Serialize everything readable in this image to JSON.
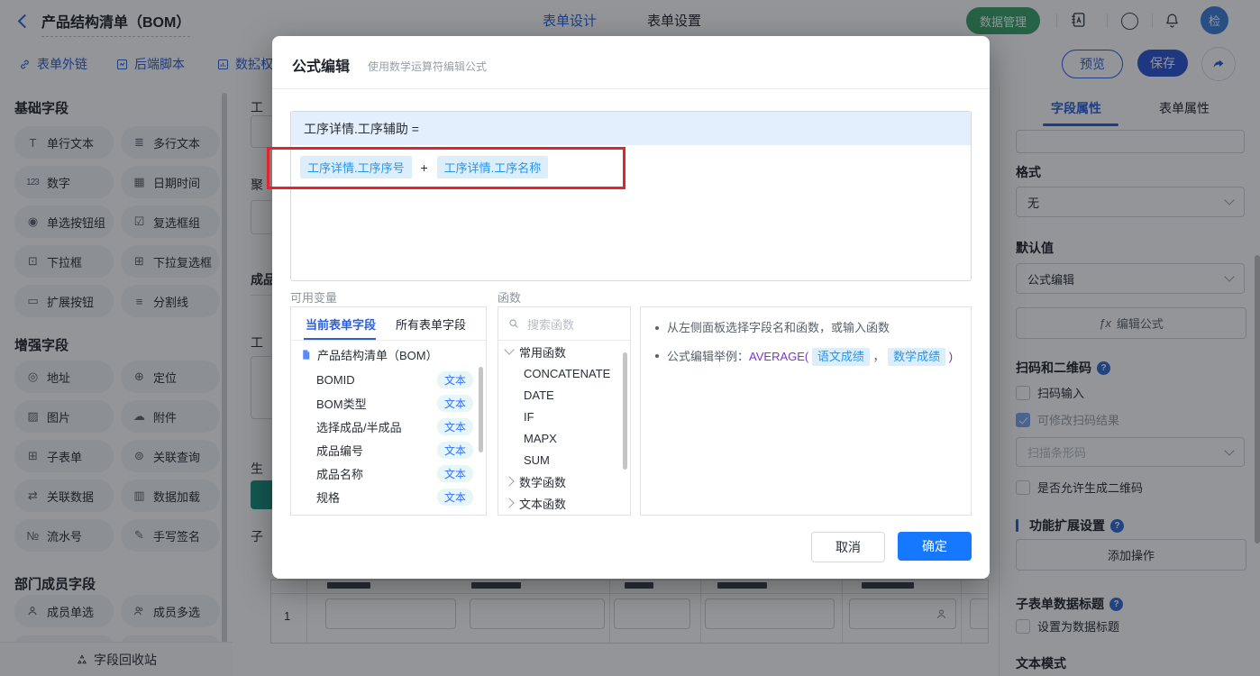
{
  "colors": {
    "primary_blue": "#2b5fd9",
    "accent_blue": "#1677ff",
    "green": "#3aa36b",
    "annotation_red": "#e5232d",
    "chip_blue": "#2196f3",
    "chip_bg": "#dcedfb"
  },
  "topbar": {
    "title": "产品结构清单（BOM）",
    "tabs": [
      {
        "label": "表单设计"
      },
      {
        "label": "表单设置"
      }
    ],
    "data_manage": "数据管理",
    "avatar": "检"
  },
  "toolbar": {
    "links": [
      {
        "label": "表单外链"
      },
      {
        "label": "后端脚本"
      },
      {
        "label": "数据权"
      }
    ],
    "preview": "预览",
    "save": "保存"
  },
  "sidebar": {
    "sections": [
      {
        "title": "基础字段",
        "items": [
          {
            "glyph": "T",
            "label": "单行文本"
          },
          {
            "glyph": "≣",
            "label": "多行文本"
          },
          {
            "glyph": "123",
            "label": "数字"
          },
          {
            "glyph": "▦",
            "label": "日期时间"
          },
          {
            "glyph": "◉",
            "label": "单选按钮组"
          },
          {
            "glyph": "☑",
            "label": "复选框组"
          },
          {
            "glyph": "⊡",
            "label": "下拉框"
          },
          {
            "glyph": "⊞",
            "label": "下拉复选框"
          },
          {
            "glyph": "▭",
            "label": "扩展按钮"
          },
          {
            "glyph": "≡",
            "label": "分割线"
          }
        ]
      },
      {
        "title": "增强字段",
        "items": [
          {
            "glyph": "◎",
            "label": "地址"
          },
          {
            "glyph": "⊕",
            "label": "定位"
          },
          {
            "glyph": "▨",
            "label": "图片"
          },
          {
            "glyph": "☁",
            "label": "附件"
          },
          {
            "glyph": "⊞",
            "label": "子表单"
          },
          {
            "glyph": "⊚",
            "label": "关联查询"
          },
          {
            "glyph": "⇄",
            "label": "关联数据"
          },
          {
            "glyph": "▥",
            "label": "数据加载"
          },
          {
            "glyph": "№",
            "label": "流水号"
          },
          {
            "glyph": "✎",
            "label": "手写签名"
          }
        ]
      },
      {
        "title": "部门成员字段",
        "items": [
          {
            "glyph": "",
            "label": "成员单选"
          },
          {
            "glyph": "",
            "label": "成员多选"
          }
        ]
      }
    ],
    "recycle": "字段回收站"
  },
  "canvas": {
    "fragments": [
      "工",
      "聚",
      "成品",
      "工",
      "生",
      "子"
    ],
    "row_number": "1"
  },
  "modal": {
    "title": "公式编辑",
    "subtitle": "使用数学运算符编辑公式",
    "formula_target": "工序详情.工序辅助 =",
    "token1": "工序详情.工序序号",
    "operator": "+",
    "token2": "工序详情.工序名称",
    "variables_label": "可用变量",
    "functions_label": "函数",
    "tab_current": "当前表单字段",
    "tab_all": "所有表单字段",
    "form_name": "产品结构清单（BOM）",
    "fields": [
      {
        "name": "BOMID",
        "type": "文本"
      },
      {
        "name": "BOM类型",
        "type": "文本"
      },
      {
        "name": "选择成品/半成品",
        "type": "文本"
      },
      {
        "name": "成品编号",
        "type": "文本"
      },
      {
        "name": "成品名称",
        "type": "文本"
      },
      {
        "name": "规格",
        "type": "文本"
      }
    ],
    "search_placeholder": "搜索函数",
    "fn_group_common": "常用函数",
    "fn_items": [
      "CONCATENATE",
      "DATE",
      "IF",
      "MAPX",
      "SUM"
    ],
    "fn_group_math": "数学函数",
    "fn_group_text": "文本函数",
    "tip1": "从左侧面板选择字段名和函数，或输入函数",
    "tip2_prefix": "公式编辑举例：",
    "tip2_fn": "AVERAGE(",
    "tip2_arg1": "语文成绩",
    "tip2_comma": "，",
    "tip2_arg2": "数学成绩",
    "tip2_close": ")",
    "cancel": "取消",
    "ok": "确定"
  },
  "props": {
    "tab_field": "字段属性",
    "tab_form": "表单属性",
    "format_label": "格式",
    "format_value": "无",
    "default_label": "默认值",
    "default_value": "公式编辑",
    "edit_formula_fx": "ƒx",
    "edit_formula": "编辑公式",
    "scan_section": "扫码和二维码",
    "scan_input": "扫码输入",
    "scan_modify": "可修改扫码结果",
    "scan_type": "扫描条形码",
    "qr_allow": "是否允许生成二维码",
    "ext_section": "功能扩展设置",
    "add_action": "添加操作",
    "subform_section": "子表单数据标题",
    "set_title": "设置为数据标题",
    "text_mode": "文本模式"
  }
}
